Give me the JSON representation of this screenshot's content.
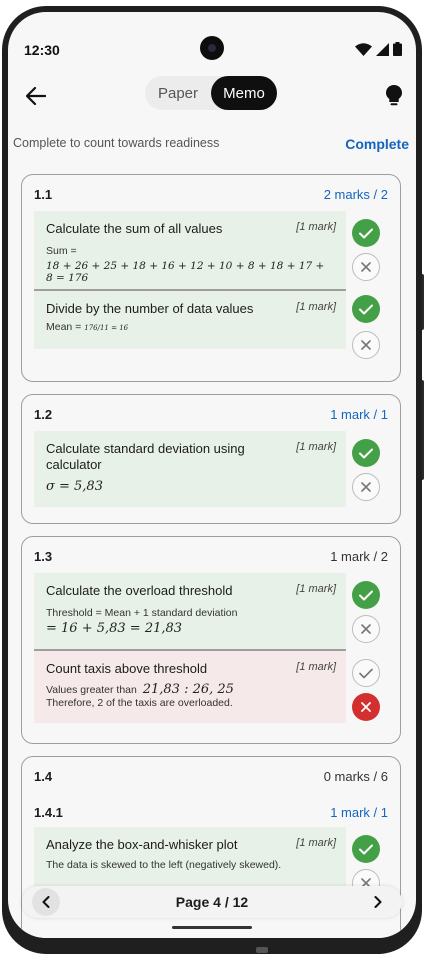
{
  "status": {
    "time": "12:30"
  },
  "appbar": {
    "tabs": [
      {
        "label": "Paper"
      },
      {
        "label": "Memo"
      }
    ],
    "active_tab": "Memo"
  },
  "readiness": {
    "text": "Complete to count towards readiness",
    "action": "Complete"
  },
  "questions": [
    {
      "id": "1.1",
      "marks": "2 marks / 2",
      "steps": [
        {
          "title": "Calculate the sum of all values",
          "mark": "[1 mark]",
          "line1": "Sum =",
          "math": "18 + 26 + 25 + 18 + 16 + 12 + 10 + 8 + 18 + 17 + 8 = 176",
          "result": "correct"
        },
        {
          "title": "Divide by the number of data values",
          "mark": "[1 mark]",
          "line1": "Mean =",
          "math": "176/11 = 16",
          "result": "correct"
        }
      ]
    },
    {
      "id": "1.2",
      "marks": "1 mark / 1",
      "steps": [
        {
          "title": "Calculate standard deviation using calculator",
          "mark": "[1 mark]",
          "math": "σ = 5,83",
          "result": "correct"
        }
      ]
    },
    {
      "id": "1.3",
      "marks": "1 mark / 2",
      "steps": [
        {
          "title": "Calculate the overload threshold",
          "mark": "[1 mark]",
          "line1": "Threshold = Mean + 1 standard deviation",
          "math": "= 16 + 5,83 = 21,83",
          "result": "correct"
        },
        {
          "title": "Count taxis above threshold",
          "mark": "[1 mark]",
          "line1": "Values greater than",
          "math": "21,83 :  26, 25",
          "line2": "Therefore, 2 of the taxis are overloaded.",
          "result": "incorrect"
        }
      ]
    },
    {
      "id": "1.4",
      "marks": "0 marks / 6",
      "sub": {
        "id": "1.4.1",
        "marks": "1 mark / 1"
      },
      "steps": [
        {
          "title": "Analyze the box-and-whisker plot",
          "mark": "[1 mark]",
          "line1": "The data is skewed to the left (negatively skewed).",
          "result": "correct"
        }
      ]
    }
  ],
  "pager": {
    "label": "Page 4 / 12"
  },
  "colors": {
    "accent": "#1565c0",
    "correct": "#43a047",
    "incorrect": "#d32f2f",
    "correct_bg": "#e8f1e8",
    "incorrect_bg": "#f6e9e9"
  }
}
